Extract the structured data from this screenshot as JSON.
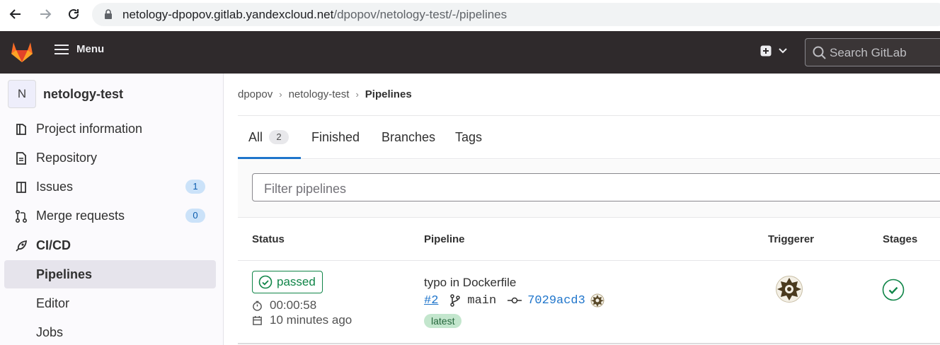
{
  "browser": {
    "url_host": "netology-dpopov.gitlab.yandexcloud.net",
    "url_path": "/dpopov/netology-test/-/pipelines"
  },
  "header": {
    "menu_label": "Menu",
    "search_placeholder": "Search GitLab"
  },
  "sidebar": {
    "project_initial": "N",
    "project_name": "netology-test",
    "items": [
      {
        "label": "Project information",
        "icon": "project-icon"
      },
      {
        "label": "Repository",
        "icon": "doc-icon"
      },
      {
        "label": "Issues",
        "icon": "issues-icon",
        "count": "1"
      },
      {
        "label": "Merge requests",
        "icon": "merge-request-icon",
        "count": "0"
      },
      {
        "label": "CI/CD",
        "icon": "rocket-icon"
      }
    ],
    "subitems": [
      {
        "label": "Pipelines",
        "active": true
      },
      {
        "label": "Editor",
        "active": false
      },
      {
        "label": "Jobs",
        "active": false
      }
    ]
  },
  "breadcrumb": [
    "dpopov",
    "netology-test",
    "Pipelines"
  ],
  "tabs": [
    {
      "label": "All",
      "count": "2"
    },
    {
      "label": "Finished"
    },
    {
      "label": "Branches"
    },
    {
      "label": "Tags"
    }
  ],
  "filter": {
    "placeholder": "Filter pipelines"
  },
  "table": {
    "headers": [
      "Status",
      "Pipeline",
      "Triggerer",
      "Stages"
    ],
    "rows": [
      {
        "status": "passed",
        "duration": "00:00:58",
        "finished": "10 minutes ago",
        "title": "typo in Dockerfile",
        "id": "#2",
        "branch": "main",
        "sha": "7029acd3",
        "tag": "latest"
      }
    ]
  },
  "colors": {
    "header_bg": "#2f2a2c",
    "success": "#108548",
    "link": "#1f75cb",
    "logo": "#fc6d26"
  }
}
